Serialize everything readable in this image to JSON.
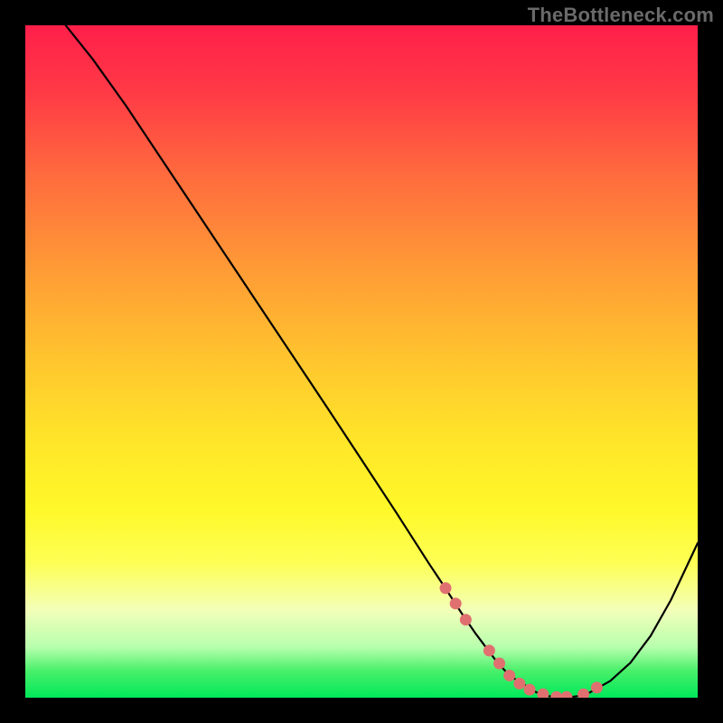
{
  "watermark": "TheBottleneck.com",
  "colors": {
    "dot": "#e07070",
    "line": "#000000"
  },
  "chart_data": {
    "type": "line",
    "title": "",
    "xlabel": "",
    "ylabel": "",
    "xlim": [
      0,
      100
    ],
    "ylim": [
      0,
      100
    ],
    "grid": false,
    "series": [
      {
        "name": "bottleneck-curve",
        "x": [
          6,
          10,
          15,
          20,
          25,
          30,
          35,
          40,
          45,
          50,
          55,
          60,
          62,
          65,
          67,
          70,
          72,
          76,
          78,
          80,
          82,
          84,
          87,
          90,
          93,
          96,
          100
        ],
        "y": [
          100,
          95,
          88,
          80.5,
          73,
          65.5,
          58,
          50.5,
          43,
          35.4,
          27.8,
          20,
          17,
          12.4,
          9.5,
          5.5,
          3.3,
          0.8,
          0.2,
          0,
          0.2,
          0.8,
          2.5,
          5.2,
          9.2,
          14.5,
          23
        ]
      }
    ],
    "annotations": {
      "floor_dots": {
        "name": "valley-dots",
        "x": [
          62.5,
          64,
          65.5,
          69,
          70.5,
          72,
          73.5,
          75,
          77,
          79,
          80.5,
          83,
          85
        ],
        "y": [
          16.3,
          14,
          11.6,
          7,
          5.1,
          3.3,
          2.1,
          1.2,
          0.5,
          0.1,
          0.1,
          0.5,
          1.5
        ]
      }
    }
  }
}
